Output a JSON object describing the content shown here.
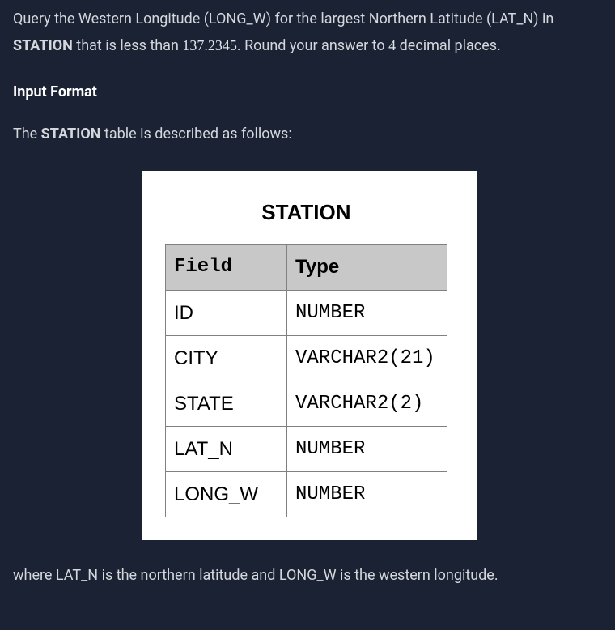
{
  "problem": {
    "part1": "Query the Western Longitude (LONG_W) for the largest Northern Latitude (LAT_N) in ",
    "station_bold": "STATION",
    "part2": " that is less than ",
    "num1": "137.2345",
    "part3": ". Round your answer to ",
    "num2": "4",
    "part4": " decimal places."
  },
  "input_format_heading": "Input Format",
  "table_intro": {
    "part1": "The ",
    "station_bold": "STATION",
    "part2": " table is described as follows:"
  },
  "table": {
    "title": "STATION",
    "headers": {
      "field": "Field",
      "type": "Type"
    },
    "rows": [
      {
        "field": "ID",
        "type": "NUMBER"
      },
      {
        "field": "CITY",
        "type": "VARCHAR2(21)"
      },
      {
        "field": "STATE",
        "type": "VARCHAR2(2)"
      },
      {
        "field": "LAT_N",
        "type": "NUMBER"
      },
      {
        "field": "LONG_W",
        "type": "NUMBER"
      }
    ]
  },
  "footer": "where LAT_N is the northern latitude and LONG_W is the western longitude."
}
